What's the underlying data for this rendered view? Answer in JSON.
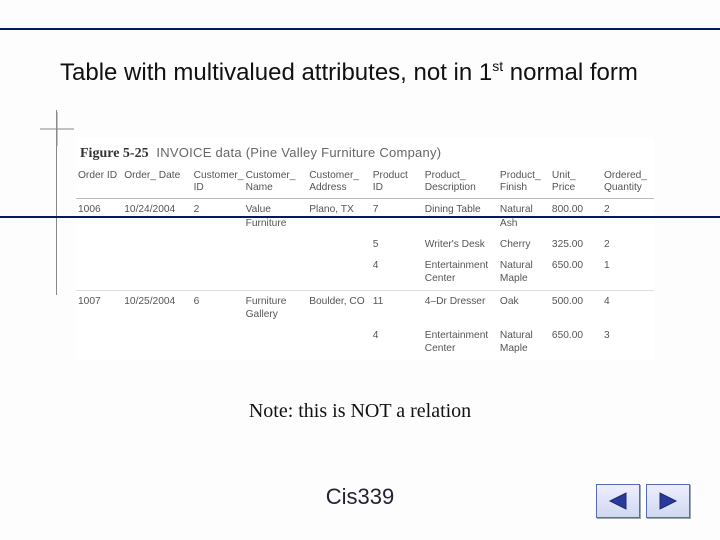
{
  "title": {
    "prefix": "Table with multivalued attributes, not in 1",
    "sup": "st",
    "suffix": " normal form"
  },
  "figure": {
    "label_bold": "Figure 5-25",
    "caption": "INVOICE data (Pine Valley Furniture Company)",
    "headers": [
      "Order ID",
      "Order_ Date",
      "Customer_ ID",
      "Customer_ Name",
      "Customer_ Address",
      "Product ID",
      "Product_ Description",
      "Product_ Finish",
      "Unit_ Price",
      "Ordered_ Quantity"
    ],
    "rows": [
      {
        "order_id": "1006",
        "order_date": "10/24/2004",
        "customer_id": "2",
        "customer_name": "Value Furniture",
        "customer_address": "Plano, TX",
        "product_id": "7",
        "product_desc": "Dining Table",
        "product_finish": "Natural Ash",
        "unit_price": "800.00",
        "qty": "2"
      },
      {
        "order_id": "",
        "order_date": "",
        "customer_id": "",
        "customer_name": "",
        "customer_address": "",
        "product_id": "5",
        "product_desc": "Writer's Desk",
        "product_finish": "Cherry",
        "unit_price": "325.00",
        "qty": "2"
      },
      {
        "order_id": "",
        "order_date": "",
        "customer_id": "",
        "customer_name": "",
        "customer_address": "",
        "product_id": "4",
        "product_desc": "Entertainment Center",
        "product_finish": "Natural Maple",
        "unit_price": "650.00",
        "qty": "1"
      },
      {
        "order_id": "1007",
        "order_date": "10/25/2004",
        "customer_id": "6",
        "customer_name": "Furniture Gallery",
        "customer_address": "Boulder, CO",
        "product_id": "11",
        "product_desc": "4–Dr Dresser",
        "product_finish": "Oak",
        "unit_price": "500.00",
        "qty": "4"
      },
      {
        "order_id": "",
        "order_date": "",
        "customer_id": "",
        "customer_name": "",
        "customer_address": "",
        "product_id": "4",
        "product_desc": "Entertainment Center",
        "product_finish": "Natural Maple",
        "unit_price": "650.00",
        "qty": "3"
      }
    ]
  },
  "note": "Note: this is NOT a relation",
  "footer": "Cis339",
  "nav": {
    "prev_icon": "triangle-left",
    "next_icon": "triangle-right"
  },
  "colors": {
    "rule": "#001a66",
    "nav_fill": "#2a3a9a"
  },
  "chart_data": {
    "type": "table",
    "title": "Figure 5-25 INVOICE data (Pine Valley Furniture Company)",
    "columns": [
      "Order ID",
      "Order_Date",
      "Customer_ID",
      "Customer_Name",
      "Customer_Address",
      "Product ID",
      "Product_Description",
      "Product_Finish",
      "Unit_Price",
      "Ordered_Quantity"
    ],
    "rows": [
      [
        "1006",
        "10/24/2004",
        "2",
        "Value Furniture",
        "Plano, TX",
        "7",
        "Dining Table",
        "Natural Ash",
        800.0,
        2
      ],
      [
        "1006",
        "10/24/2004",
        "2",
        "Value Furniture",
        "Plano, TX",
        "5",
        "Writer's Desk",
        "Cherry",
        325.0,
        2
      ],
      [
        "1006",
        "10/24/2004",
        "2",
        "Value Furniture",
        "Plano, TX",
        "4",
        "Entertainment Center",
        "Natural Maple",
        650.0,
        1
      ],
      [
        "1007",
        "10/25/2004",
        "6",
        "Furniture Gallery",
        "Boulder, CO",
        "11",
        "4–Dr Dresser",
        "Oak",
        500.0,
        4
      ],
      [
        "1007",
        "10/25/2004",
        "6",
        "Furniture Gallery",
        "Boulder, CO",
        "4",
        "Entertainment Center",
        "Natural Maple",
        650.0,
        3
      ]
    ]
  }
}
